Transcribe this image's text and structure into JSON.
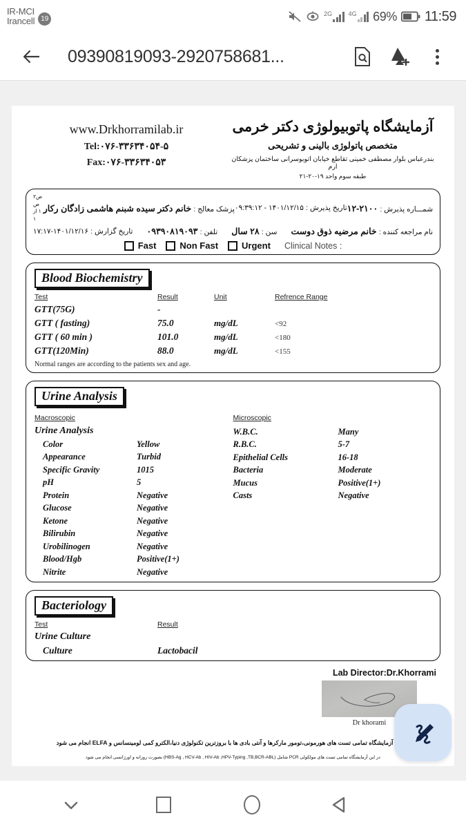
{
  "status_bar": {
    "carrier_line1": "IR-MCI",
    "carrier_line2": "Irancell",
    "sim_badge": "19",
    "network_1": "2G",
    "network_2": "4G",
    "battery_percent": "69%",
    "clock": "11:59",
    "icons": [
      "mute-icon",
      "eye-icon",
      "signal-icon",
      "battery-icon"
    ]
  },
  "app_bar": {
    "back_icon": "back-arrow-icon",
    "title": "09390819093-2920758681...",
    "search_doc_icon": "document-search-icon",
    "drive_add_icon": "drive-add-icon",
    "overflow_icon": "more-options-icon"
  },
  "document": {
    "header": {
      "website": "www.Drkhorramilab.ir",
      "tel": "Tel:۰۷۶-۳۳۶۳۴۰۵۴-۵",
      "fax": "Fax:۰۷۶-۳۳۶۳۴۰۵۳",
      "lab_name": "آزمایشگاه پاتوبیولوژی دکتر خرمی",
      "lab_specialty": "متخصص پاتولوژی بالینی و تشریحی",
      "lab_address": "بندرعباس بلوار مصطفی خمینی تقاطع خیابان اتوبوسرانی ساختمان پزشکان ارم",
      "lab_address2": "طبقه سوم واحد ۱۹-۲۰-۲۱"
    },
    "patient": {
      "admission_no_label": "شمـــاره پذیرش :",
      "admission_no_value": "۲۱۰۰-۱۲",
      "admission_date_label": "تاریخ پذیرش :",
      "admission_date_value": "۱۴۰۱/۱۲/۱۵ - ۰۹:۳۹:۱۲",
      "doctor_label": "پزشک معالج :",
      "doctor_value": "خانم دکتر سیده شبنم هاشمی زادگان رکار",
      "page_mark": "ص۲\nص ۱ از ۱",
      "patient_label": "نام مراجعه کننده :",
      "patient_value": "خانم مرضیه ذوق دوست",
      "age_label": "سن :",
      "age_value": "۲۸ سال",
      "phone_label": "تلفن :",
      "phone_value": "۰۹۳۹۰۸۱۹۰۹۳",
      "report_date_label": "تاریخ گزارش :",
      "report_date_value": "۱۴۰۱/۱۲/۱۶-۱۷:۱۷",
      "fast_label": "Fast",
      "non_fast_label": "Non Fast",
      "urgent_label": "Urgent",
      "clinical_notes_label": "Clinical Notes :"
    },
    "blood_biochemistry": {
      "title": "Blood Biochemistry",
      "headers": [
        "Test",
        "Result",
        "Unit",
        "Refrence Range"
      ],
      "rows": [
        {
          "test": "GTT(75G)",
          "result": "-",
          "unit": "",
          "ref": ""
        },
        {
          "test": "GTT ( fasting)",
          "result": "75.0",
          "unit": "mg/dL",
          "ref": "<92"
        },
        {
          "test": "GTT ( 60 min )",
          "result": "101.0",
          "unit": "mg/dL",
          "ref": "<180"
        },
        {
          "test": "GTT(120Min)",
          "result": "88.0",
          "unit": "mg/dL",
          "ref": "<155"
        }
      ],
      "note": "Normal ranges are according to the patients sex and age."
    },
    "urine_analysis": {
      "title": "Urine Analysis",
      "macroscopic_label": "Macroscopic",
      "macroscopic_group": "Urine Analysis",
      "macroscopic_rows": [
        {
          "k": "Color",
          "v": "Yellow"
        },
        {
          "k": "Appearance",
          "v": "Turbid"
        },
        {
          "k": "Specific Gravity",
          "v": "1015"
        },
        {
          "k": "pH",
          "v": "5"
        },
        {
          "k": "Protein",
          "v": "Negative"
        },
        {
          "k": "Glucose",
          "v": "Negative"
        },
        {
          "k": "Ketone",
          "v": "Negative"
        },
        {
          "k": "Bilirubin",
          "v": "Negative"
        },
        {
          "k": "Urobilinogen",
          "v": "Negative"
        },
        {
          "k": "Blood/Hgb",
          "v": "Positive(1+)"
        },
        {
          "k": "Nitrite",
          "v": "Negative"
        }
      ],
      "microscopic_label": "Microscopic",
      "microscopic_rows": [
        {
          "k": "W.B.C.",
          "v": "Many"
        },
        {
          "k": "R.B.C.",
          "v": "5-7"
        },
        {
          "k": "Epithelial Cells",
          "v": "16-18"
        },
        {
          "k": "Bacteria",
          "v": "Moderate"
        },
        {
          "k": "Mucus",
          "v": "Positive(1+)"
        },
        {
          "k": "Casts",
          "v": "Negative"
        }
      ]
    },
    "bacteriology": {
      "title": "Bacteriology",
      "headers": [
        "Test",
        "Result"
      ],
      "group": "Urine  Culture",
      "rows": [
        {
          "test": "Culture",
          "result": "Lactobacil"
        }
      ]
    },
    "signature": {
      "director_label": "Lab Director:Dr.Khorrami",
      "signature_name": "Dr khorami"
    },
    "footer": {
      "line1": "در این آزمایشگاه تمامی تست های هورمونی،تومور مارکرها و آنتی بادی ها با بروزترین تکنولوژی دنیا،الکترو کمی لومینسانس و ELFA انجام می شود",
      "line2": "در این آزمایشگاه تمامی تست های مولکولی PCR شامل (HBS-Ag , HCV-Ab , HIV-Ab ,HPV-Typing ,TB,BCR-ABL) بصورت روزانه و اورژانسی انجام می شود"
    }
  },
  "fab": {
    "icon": "signature-pen-icon"
  },
  "nav_bar": {
    "items": [
      {
        "icon": "chevron-down-icon",
        "name": "hide-keyboard"
      },
      {
        "icon": "square-icon",
        "name": "recents"
      },
      {
        "icon": "circle-icon",
        "name": "home"
      },
      {
        "icon": "triangle-left-icon",
        "name": "back"
      }
    ]
  },
  "colors": {
    "fab_bg": "#d5e3f7",
    "fab_icon": "#12244a",
    "viewer_bg": "#f0f0f0"
  }
}
